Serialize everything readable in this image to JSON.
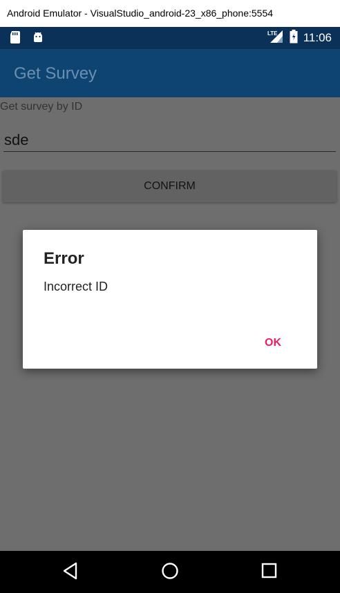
{
  "window": {
    "title": "Android Emulator - VisualStudio_android-23_x86_phone:5554"
  },
  "status_bar": {
    "time": "11:06",
    "network": "LTE",
    "left_icons": [
      "sd-card-icon",
      "android-icon"
    ],
    "right_icons": [
      "lte-signal-icon",
      "battery-icon"
    ]
  },
  "app_bar": {
    "title": "Get Survey"
  },
  "form": {
    "label": "Get survey by ID",
    "input_value": "sde",
    "confirm_label": "CONFIRM"
  },
  "dialog": {
    "title": "Error",
    "message": "Incorrect ID",
    "ok_label": "OK"
  },
  "nav": {
    "icons": [
      "back-icon",
      "home-icon",
      "recents-icon"
    ]
  },
  "colors": {
    "status_bar": "#0b3158",
    "app_bar": "#0d4472",
    "accent": "#e91e63",
    "scrim": "#6e6e6e"
  }
}
